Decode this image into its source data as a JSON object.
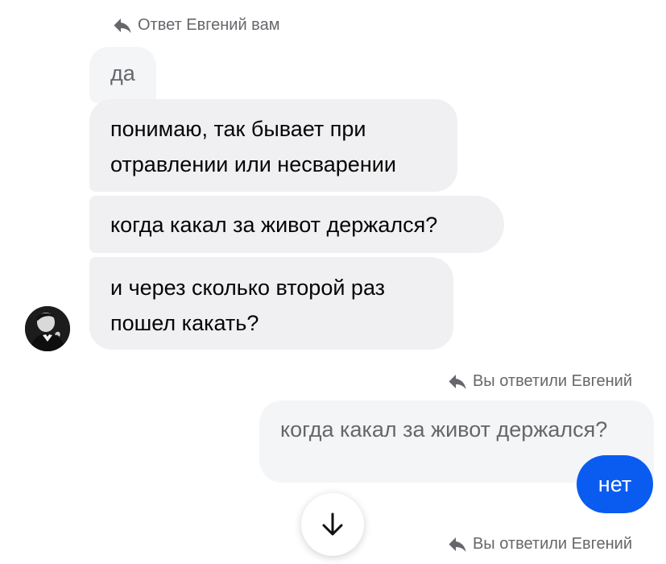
{
  "received": {
    "reply_note": "Ответ Евгений вам",
    "quoted_message": "да",
    "messages": [
      {
        "lines": [
          "понимаю, так бывает при",
          "отравлении или несварении"
        ]
      },
      {
        "lines": [
          "когда какал за живот держался?"
        ]
      },
      {
        "lines": [
          "и через сколько второй раз",
          "пошел какать?"
        ]
      }
    ],
    "avatar_icon": "profile-photo"
  },
  "sent": {
    "reply_note": "Вы ответили Евгений",
    "quoted_message": "когда какал за живот держался?",
    "message": "нет",
    "next_reply_note": "Вы ответили Евгений"
  },
  "scroll_button": {
    "icon": "arrow-down-icon"
  },
  "colors": {
    "received_bubble": "#f0f0f2",
    "quoted_bubble": "#f4f5f7",
    "sent_bubble": "#0a5cf0",
    "muted_text": "#65676b",
    "text": "#050505"
  }
}
